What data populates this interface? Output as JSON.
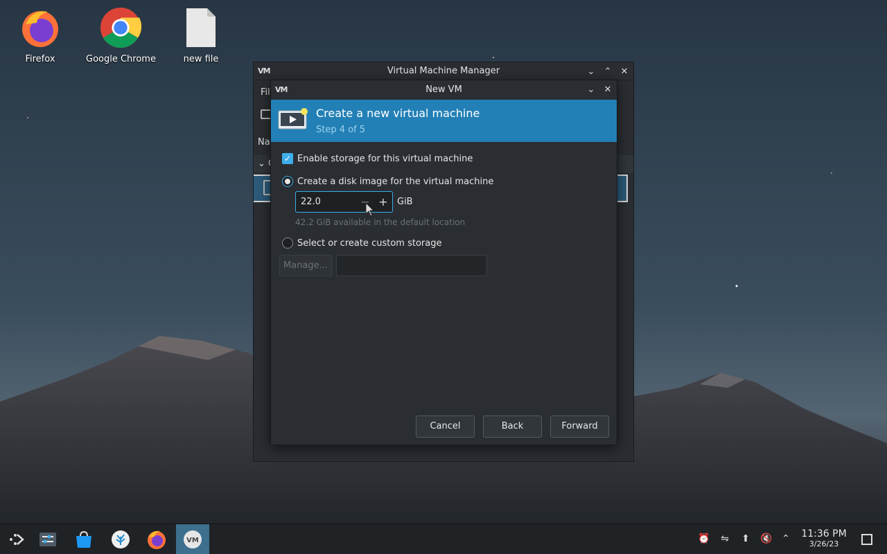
{
  "desktop": {
    "icons": [
      {
        "label": "Firefox"
      },
      {
        "label": "Google Chrome"
      },
      {
        "label": "new file"
      }
    ]
  },
  "vmm_window": {
    "title": "Virtual Machine Manager",
    "menu_partial": "File",
    "column_partial": "Nam",
    "group_partial": "Q"
  },
  "dialog": {
    "title": "New VM",
    "header_title": "Create a new virtual machine",
    "header_step": "Step 4 of 5",
    "enable_storage_label": "Enable storage for this virtual machine",
    "enable_storage_checked": true,
    "create_disk_label": "Create a disk image for the virtual machine",
    "create_disk_selected": true,
    "disk_size_value": "22.0",
    "disk_size_unit": "GiB",
    "available_text": "42.2 GiB available in the default location",
    "custom_storage_label": "Select or create custom storage",
    "custom_storage_selected": false,
    "manage_label": "Manage...",
    "custom_path_value": "",
    "buttons": {
      "cancel": "Cancel",
      "back": "Back",
      "forward": "Forward"
    }
  },
  "taskbar": {
    "apps": [
      {
        "icon": "app-launcher-icon"
      },
      {
        "icon": "system-settings-icon"
      },
      {
        "icon": "discover-store-icon"
      },
      {
        "icon": "coral-app-icon"
      },
      {
        "icon": "firefox-icon"
      },
      {
        "icon": "virt-manager-icon",
        "active": true
      }
    ],
    "tray": [
      "notifications-icon",
      "network-icon",
      "updates-icon",
      "volume-muted-icon",
      "expand-tray-icon"
    ],
    "time": "11:36 PM",
    "date": "3/26/23"
  },
  "colors": {
    "accent": "#3daee9",
    "header_banner": "#2380b6",
    "window_bg": "#2a2e32",
    "taskbar_bg": "#202326"
  }
}
